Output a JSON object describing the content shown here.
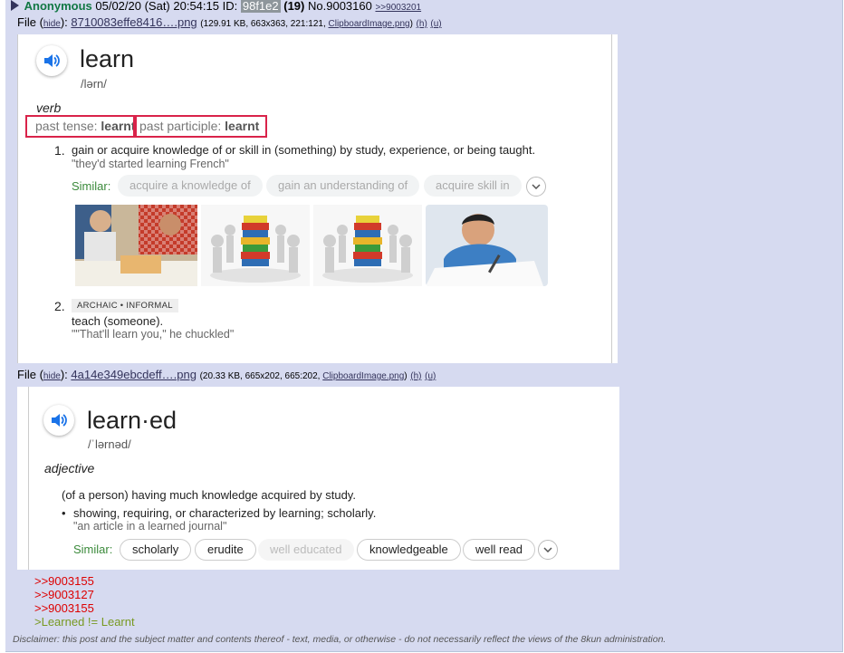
{
  "post": {
    "name": "Anonymous",
    "date": "05/02/20 (Sat) 20:54:15",
    "id_label": "ID:",
    "id_value": "98f1e2",
    "id_count": "(19)",
    "post_no": "No.9003160",
    "backlink": ">>9003201"
  },
  "files": [
    {
      "label": "File",
      "hide": "hide",
      "filename": "8710083effe8416….png",
      "meta_pre": "(129.91 KB, 663x363, 221:121,",
      "orig": "ClipboardImage.png",
      "meta_post": ")",
      "h": "(h)",
      "u": "(u)"
    },
    {
      "label": "File",
      "hide": "hide",
      "filename": "4a14e349ebcdeff….png",
      "meta_pre": "(20.33 KB, 665x202, 665:202,",
      "orig": "ClipboardImage.png",
      "meta_post": ")",
      "h": "(h)",
      "u": "(u)"
    }
  ],
  "image1": {
    "word": "learn",
    "pronunciation": "/lərn/",
    "part_of_speech": "verb",
    "past_tense_label": "past tense:",
    "past_tense_value": "learnt",
    "past_participle_label": "past participle:",
    "past_participle_value": "learnt",
    "def1_num": "1.",
    "def1_text": "gain or acquire knowledge of or skill in (something) by study, experience, or being taught.",
    "def1_example": "\"they'd started learning French\"",
    "similar_label": "Similar:",
    "similar": [
      "acquire a knowledge of",
      "gain an understanding of",
      "acquire skill in"
    ],
    "def2_num": "2.",
    "def2_tag": "ARCHAIC • INFORMAL",
    "def2_text": "teach (someone).",
    "def2_example": "\"\"That'll learn you,\" he chuckled\""
  },
  "image2": {
    "word": "learn·ed",
    "pronunciation": "/ˈlərnəd/",
    "part_of_speech": "adjective",
    "def1_text": "(of a person) having much knowledge acquired by study.",
    "bullet": "•",
    "def2_text": "showing, requiring, or characterized by learning; scholarly.",
    "def2_example": "\"an article in a learned journal\"",
    "similar_label": "Similar:",
    "similar": [
      "scholarly",
      "erudite",
      "well educated",
      "knowledgeable",
      "well read"
    ]
  },
  "body": {
    "quotes": [
      ">>9003155",
      ">>9003127",
      ">>9003155"
    ],
    "greentext": ">Learned != Learnt"
  },
  "disclaimer": "Disclaimer: this post and the subject matter and contents thereof - text, media, or otherwise - do not necessarily reflect the views of the 8kun administration.",
  "colors": {
    "post_bg": "#d6daf0",
    "name": "#117743",
    "quote_link": "#dd0000",
    "greentext": "#789922",
    "highlight_box": "#d9234a",
    "similar_label": "#3b8a3b"
  }
}
